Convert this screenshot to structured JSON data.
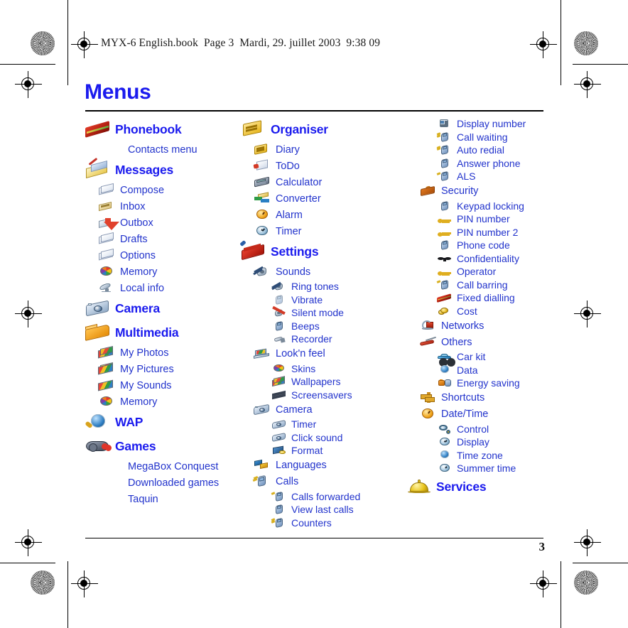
{
  "document": {
    "book_header": "MYX-6 English.book  Page 3  Mardi, 29. juillet 2003  9:38 09",
    "title": "Menus",
    "page_number": "3"
  },
  "colors": {
    "heading_blue": "#1b1bee",
    "item_blue": "#2233cc",
    "rule_black": "#000000",
    "background": "#ffffff"
  },
  "columns": [
    {
      "id": "col1",
      "items": [
        {
          "level": 1,
          "label": "Phonebook",
          "icon": "address-book-icon"
        },
        {
          "level": "plain",
          "label": "Contacts menu",
          "icon": "none"
        },
        {
          "level": 1,
          "label": "Messages",
          "icon": "messages-envelope-icon"
        },
        {
          "level": 2,
          "label": "Compose",
          "icon": "compose-message-icon"
        },
        {
          "level": 2,
          "label": "Inbox",
          "icon": "inbox-icon"
        },
        {
          "level": 2,
          "label": "Outbox",
          "icon": "outbox-icon"
        },
        {
          "level": 2,
          "label": "Drafts",
          "icon": "drafts-icon"
        },
        {
          "level": 2,
          "label": "Options",
          "icon": "options-cards-icon"
        },
        {
          "level": 2,
          "label": "Memory",
          "icon": "memory-palette-icon"
        },
        {
          "level": 2,
          "label": "Local info",
          "icon": "local-info-antenna-icon"
        },
        {
          "level": 1,
          "label": "Camera",
          "icon": "camera-icon"
        },
        {
          "level": 1,
          "label": "Multimedia",
          "icon": "multimedia-folder-icon"
        },
        {
          "level": 2,
          "label": "My Photos",
          "icon": "my-photos-icon"
        },
        {
          "level": 2,
          "label": "My Pictures",
          "icon": "my-pictures-icon"
        },
        {
          "level": 2,
          "label": "My Sounds",
          "icon": "my-sounds-icon"
        },
        {
          "level": 2,
          "label": "Memory",
          "icon": "memory-palette-icon"
        },
        {
          "level": 1,
          "label": "WAP",
          "icon": "wap-globe-icon"
        },
        {
          "level": 1,
          "label": "Games",
          "icon": "games-gamepad-icon"
        },
        {
          "level": "plain",
          "label": "MegaBox Conquest",
          "icon": "none"
        },
        {
          "level": "plain",
          "label": "Downloaded games",
          "icon": "none"
        },
        {
          "level": "plain",
          "label": "Taquin",
          "icon": "none"
        }
      ]
    },
    {
      "id": "col2",
      "items": [
        {
          "level": 1,
          "label": "Organiser",
          "icon": "organiser-icon"
        },
        {
          "level": 2,
          "label": "Diary",
          "icon": "diary-icon"
        },
        {
          "level": 2,
          "label": "ToDo",
          "icon": "todo-icon"
        },
        {
          "level": 2,
          "label": "Calculator",
          "icon": "calculator-icon"
        },
        {
          "level": 2,
          "label": "Converter",
          "icon": "converter-icon"
        },
        {
          "level": 2,
          "label": "Alarm",
          "icon": "alarm-clock-icon"
        },
        {
          "level": 2,
          "label": "Timer",
          "icon": "timer-clock-icon"
        },
        {
          "level": 1,
          "label": "Settings",
          "icon": "settings-toolbox-icon"
        },
        {
          "level": 2,
          "label": "Sounds",
          "icon": "sounds-speaker-icon"
        },
        {
          "level": 3,
          "label": "Ring tones",
          "icon": "ring-tones-icon"
        },
        {
          "level": 3,
          "label": "Vibrate",
          "icon": "vibrate-icon"
        },
        {
          "level": 3,
          "label": "Silent mode",
          "icon": "silent-mode-icon"
        },
        {
          "level": 3,
          "label": "Beeps",
          "icon": "beeps-icon"
        },
        {
          "level": 3,
          "label": "Recorder",
          "icon": "recorder-microphone-icon"
        },
        {
          "level": 2,
          "label": "Look'n feel",
          "icon": "looknfeel-laptop-icon"
        },
        {
          "level": 3,
          "label": "Skins",
          "icon": "skins-palette-icon"
        },
        {
          "level": 3,
          "label": "Wallpapers",
          "icon": "wallpapers-icon"
        },
        {
          "level": 3,
          "label": "Screensavers",
          "icon": "screensavers-film-icon"
        },
        {
          "level": 2,
          "label": "Camera",
          "icon": "camera-icon"
        },
        {
          "level": 3,
          "label": "Timer",
          "icon": "camera-timer-icon"
        },
        {
          "level": 3,
          "label": "Click sound",
          "icon": "click-sound-icon"
        },
        {
          "level": 3,
          "label": "Format",
          "icon": "format-icon"
        },
        {
          "level": 2,
          "label": "Languages",
          "icon": "languages-flags-icon"
        },
        {
          "level": 2,
          "label": "Calls",
          "icon": "calls-icon"
        },
        {
          "level": 3,
          "label": "Calls forwarded",
          "icon": "calls-forwarded-icon"
        },
        {
          "level": 3,
          "label": "View last calls",
          "icon": "view-last-calls-icon"
        },
        {
          "level": 3,
          "label": "Counters",
          "icon": "counters-icon"
        }
      ]
    },
    {
      "id": "col3",
      "items": [
        {
          "level": 3,
          "label": "Display number",
          "icon": "display-number-id-icon"
        },
        {
          "level": 3,
          "label": "Call waiting",
          "icon": "call-waiting-icon"
        },
        {
          "level": 3,
          "label": "Auto redial",
          "icon": "auto-redial-icon"
        },
        {
          "level": 3,
          "label": "Answer phone",
          "icon": "answer-phone-icon"
        },
        {
          "level": 3,
          "label": "ALS",
          "icon": "als-icon"
        },
        {
          "level": 2,
          "label": "Security",
          "icon": "security-briefcase-icon"
        },
        {
          "level": 3,
          "label": "Keypad locking",
          "icon": "keypad-locking-key-icon"
        },
        {
          "level": 3,
          "label": "PIN number",
          "icon": "pin-number-icon"
        },
        {
          "level": 3,
          "label": "PIN number 2",
          "icon": "pin-number-2-icon"
        },
        {
          "level": 3,
          "label": "Phone code",
          "icon": "phone-code-icon"
        },
        {
          "level": 3,
          "label": "Confidentiality",
          "icon": "confidentiality-sunglasses-icon"
        },
        {
          "level": 3,
          "label": "Operator",
          "icon": "operator-icon"
        },
        {
          "level": 3,
          "label": "Call barring",
          "icon": "call-barring-icon"
        },
        {
          "level": 3,
          "label": "Fixed dialling",
          "icon": "fixed-dialling-book-icon"
        },
        {
          "level": 3,
          "label": "Cost",
          "icon": "cost-coins-icon"
        },
        {
          "level": 2,
          "label": "Networks",
          "icon": "networks-antenna-icon"
        },
        {
          "level": 2,
          "label": "Others",
          "icon": "others-knife-icon"
        },
        {
          "level": 3,
          "label": "Car kit",
          "icon": "car-kit-icon"
        },
        {
          "level": 3,
          "label": "Data",
          "icon": "data-globe-icon"
        },
        {
          "level": 3,
          "label": "Energy saving",
          "icon": "energy-saving-battery-icon"
        },
        {
          "level": 2,
          "label": "Shortcuts",
          "icon": "shortcuts-signpost-icon"
        },
        {
          "level": 2,
          "label": "Date/Time",
          "icon": "date-time-clock-icon"
        },
        {
          "level": 3,
          "label": "Control",
          "icon": "control-magnifier-icon"
        },
        {
          "level": 3,
          "label": "Display",
          "icon": "display-clock-icon"
        },
        {
          "level": 3,
          "label": "Time zone",
          "icon": "time-zone-globe-icon"
        },
        {
          "level": 3,
          "label": "Summer time",
          "icon": "summer-time-clock-icon"
        },
        {
          "level": 1,
          "label": "Services",
          "icon": "services-bell-icon"
        }
      ]
    }
  ],
  "press_marks": {
    "registration_target_name": "registration-crosshair",
    "star_target_name": "star-density-target",
    "crop_line_name": "crop-mark-line"
  }
}
